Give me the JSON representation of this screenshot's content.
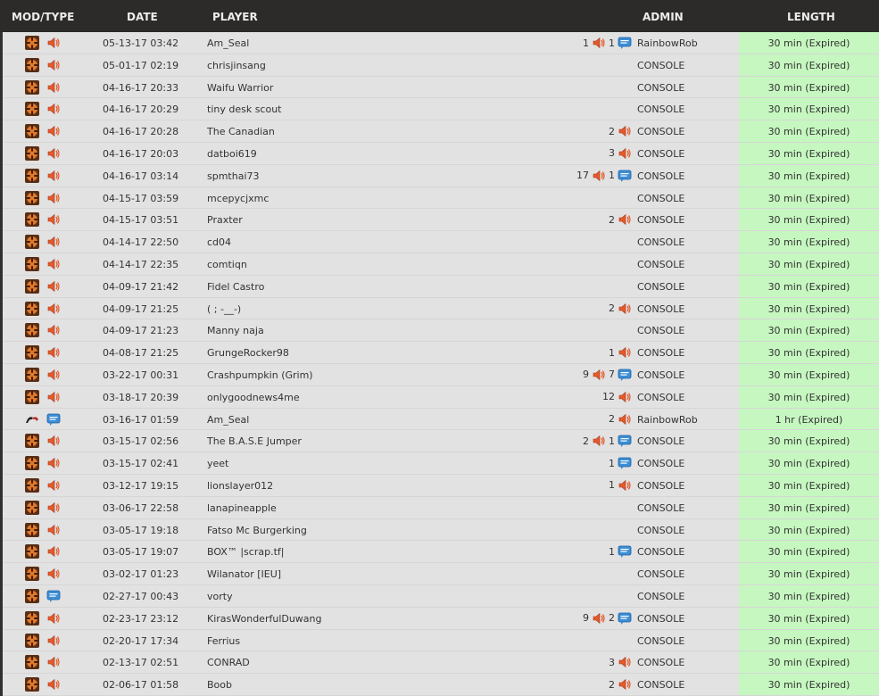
{
  "header": {
    "mod_type": "MOD/TYPE",
    "date": "DATE",
    "player": "PLAYER",
    "admin": "ADMIN",
    "length": "LENGTH"
  },
  "icons": {
    "tf2": "tf2-game-icon",
    "other": "other-game-icon",
    "mute": "mute-speaker-icon",
    "gag": "gag-chat-icon"
  },
  "colors": {
    "header_bg": "#2c2b2a",
    "row_bg": "#e2e2e2",
    "length_bg": "#c6f7c0"
  },
  "rows": [
    {
      "mod": "tf2",
      "type": "mute",
      "date": "05-13-17 03:42",
      "player": "Am_Seal",
      "mutes": "1",
      "gags": "1",
      "admin": "RainbowRob",
      "length": "30 min (Expired)"
    },
    {
      "mod": "tf2",
      "type": "mute",
      "date": "05-01-17 02:19",
      "player": "chrisjinsang",
      "mutes": "",
      "gags": "",
      "admin": "CONSOLE",
      "length": "30 min (Expired)"
    },
    {
      "mod": "tf2",
      "type": "mute",
      "date": "04-16-17 20:33",
      "player": "Waifu Warrior",
      "mutes": "",
      "gags": "",
      "admin": "CONSOLE",
      "length": "30 min (Expired)"
    },
    {
      "mod": "tf2",
      "type": "mute",
      "date": "04-16-17 20:29",
      "player": "tiny desk scout",
      "mutes": "",
      "gags": "",
      "admin": "CONSOLE",
      "length": "30 min (Expired)"
    },
    {
      "mod": "tf2",
      "type": "mute",
      "date": "04-16-17 20:28",
      "player": "The Canadian",
      "mutes": "2",
      "gags": "",
      "admin": "CONSOLE",
      "length": "30 min (Expired)"
    },
    {
      "mod": "tf2",
      "type": "mute",
      "date": "04-16-17 20:03",
      "player": "datboi619",
      "mutes": "3",
      "gags": "",
      "admin": "CONSOLE",
      "length": "30 min (Expired)"
    },
    {
      "mod": "tf2",
      "type": "mute",
      "date": "04-16-17 03:14",
      "player": "spmthai73",
      "mutes": "17",
      "gags": "1",
      "admin": "CONSOLE",
      "length": "30 min (Expired)"
    },
    {
      "mod": "tf2",
      "type": "mute",
      "date": "04-15-17 03:59",
      "player": "mcepycjxmc",
      "mutes": "",
      "gags": "",
      "admin": "CONSOLE",
      "length": "30 min (Expired)"
    },
    {
      "mod": "tf2",
      "type": "mute",
      "date": "04-15-17 03:51",
      "player": "Praxter",
      "mutes": "2",
      "gags": "",
      "admin": "CONSOLE",
      "length": "30 min (Expired)"
    },
    {
      "mod": "tf2",
      "type": "mute",
      "date": "04-14-17 22:50",
      "player": "cd04",
      "mutes": "",
      "gags": "",
      "admin": "CONSOLE",
      "length": "30 min (Expired)"
    },
    {
      "mod": "tf2",
      "type": "mute",
      "date": "04-14-17 22:35",
      "player": "comtiqn",
      "mutes": "",
      "gags": "",
      "admin": "CONSOLE",
      "length": "30 min (Expired)"
    },
    {
      "mod": "tf2",
      "type": "mute",
      "date": "04-09-17 21:42",
      "player": "Fidel Castro",
      "mutes": "",
      "gags": "",
      "admin": "CONSOLE",
      "length": "30 min (Expired)"
    },
    {
      "mod": "tf2",
      "type": "mute",
      "date": "04-09-17 21:25",
      "player": "( ; -__-)",
      "mutes": "2",
      "gags": "",
      "admin": "CONSOLE",
      "length": "30 min (Expired)"
    },
    {
      "mod": "tf2",
      "type": "mute",
      "date": "04-09-17 21:23",
      "player": "Manny naja",
      "mutes": "",
      "gags": "",
      "admin": "CONSOLE",
      "length": "30 min (Expired)"
    },
    {
      "mod": "tf2",
      "type": "mute",
      "date": "04-08-17 21:25",
      "player": "GrungeRocker98",
      "mutes": "1",
      "gags": "",
      "admin": "CONSOLE",
      "length": "30 min (Expired)"
    },
    {
      "mod": "tf2",
      "type": "mute",
      "date": "03-22-17 00:31",
      "player": "Crashpumpkin (Grim)",
      "mutes": "9",
      "gags": "7",
      "admin": "CONSOLE",
      "length": "30 min (Expired)"
    },
    {
      "mod": "tf2",
      "type": "mute",
      "date": "03-18-17 20:39",
      "player": "onlygoodnews4me",
      "mutes": "12",
      "gags": "",
      "admin": "CONSOLE",
      "length": "30 min (Expired)"
    },
    {
      "mod": "other",
      "type": "gag",
      "date": "03-16-17 01:59",
      "player": "Am_Seal",
      "mutes": "2",
      "gags": "",
      "admin": "RainbowRob",
      "length": "1 hr (Expired)"
    },
    {
      "mod": "tf2",
      "type": "mute",
      "date": "03-15-17 02:56",
      "player": "The B.A.S.E Jumper",
      "mutes": "2",
      "gags": "1",
      "admin": "CONSOLE",
      "length": "30 min (Expired)"
    },
    {
      "mod": "tf2",
      "type": "mute",
      "date": "03-15-17 02:41",
      "player": "yeet",
      "mutes": "",
      "gags": "1",
      "admin": "CONSOLE",
      "length": "30 min (Expired)"
    },
    {
      "mod": "tf2",
      "type": "mute",
      "date": "03-12-17 19:15",
      "player": "lionslayer012",
      "mutes": "1",
      "gags": "",
      "admin": "CONSOLE",
      "length": "30 min (Expired)"
    },
    {
      "mod": "tf2",
      "type": "mute",
      "date": "03-06-17 22:58",
      "player": "lanapineapple",
      "mutes": "",
      "gags": "",
      "admin": "CONSOLE",
      "length": "30 min (Expired)"
    },
    {
      "mod": "tf2",
      "type": "mute",
      "date": "03-05-17 19:18",
      "player": "Fatso Mc Burgerking",
      "mutes": "",
      "gags": "",
      "admin": "CONSOLE",
      "length": "30 min (Expired)"
    },
    {
      "mod": "tf2",
      "type": "mute",
      "date": "03-05-17 19:07",
      "player": "BOX™ |scrap.tf|",
      "mutes": "",
      "gags": "1",
      "admin": "CONSOLE",
      "length": "30 min (Expired)"
    },
    {
      "mod": "tf2",
      "type": "mute",
      "date": "03-02-17 01:23",
      "player": "Wilanator [IEU]",
      "mutes": "",
      "gags": "",
      "admin": "CONSOLE",
      "length": "30 min (Expired)"
    },
    {
      "mod": "tf2",
      "type": "gag",
      "date": "02-27-17 00:43",
      "player": "vorty",
      "mutes": "",
      "gags": "",
      "admin": "CONSOLE",
      "length": "30 min (Expired)"
    },
    {
      "mod": "tf2",
      "type": "mute",
      "date": "02-23-17 23:12",
      "player": "KirasWonderfulDuwang",
      "mutes": "9",
      "gags": "2",
      "admin": "CONSOLE",
      "length": "30 min (Expired)"
    },
    {
      "mod": "tf2",
      "type": "mute",
      "date": "02-20-17 17:34",
      "player": "Ferrius",
      "mutes": "",
      "gags": "",
      "admin": "CONSOLE",
      "length": "30 min (Expired)"
    },
    {
      "mod": "tf2",
      "type": "mute",
      "date": "02-13-17 02:51",
      "player": "CONRAD",
      "mutes": "3",
      "gags": "",
      "admin": "CONSOLE",
      "length": "30 min (Expired)"
    },
    {
      "mod": "tf2",
      "type": "mute",
      "date": "02-06-17 01:58",
      "player": "Boob",
      "mutes": "2",
      "gags": "",
      "admin": "CONSOLE",
      "length": "30 min (Expired)"
    }
  ]
}
